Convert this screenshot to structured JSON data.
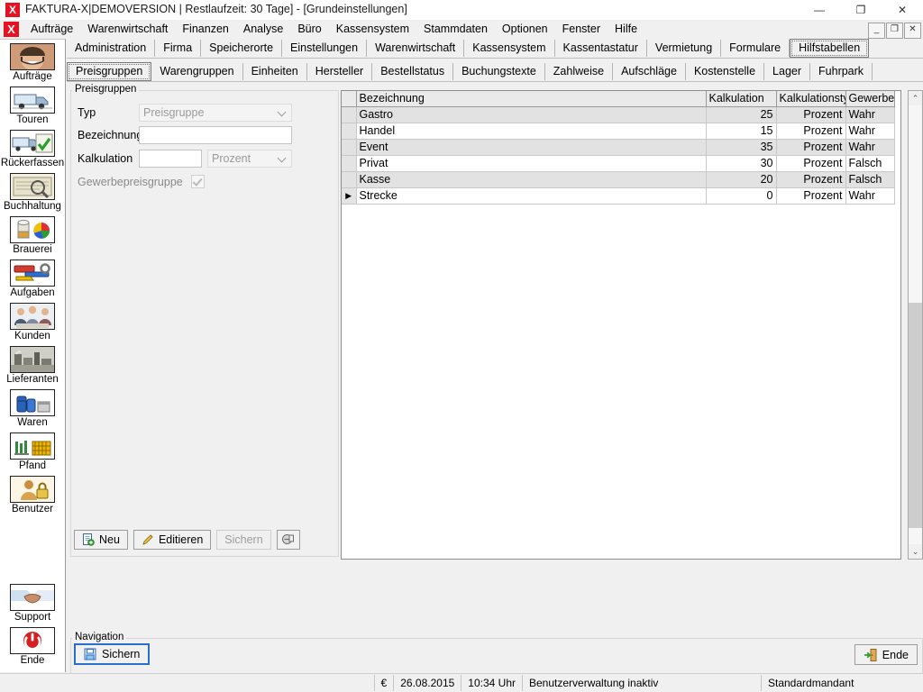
{
  "window": {
    "title": "FAKTURA-X|DEMOVERSION | Restlaufzeit: 30 Tage] - [Grundeinstellungen]",
    "logo_text": "X",
    "minimize": "—",
    "maximize": "❐",
    "close": "✕",
    "mdi_minimize": "_",
    "mdi_restore": "❐",
    "mdi_close": "✕"
  },
  "menubar": {
    "logo_text": "X",
    "items": [
      "Aufträge",
      "Warenwirtschaft",
      "Finanzen",
      "Analyse",
      "Büro",
      "Kassensystem",
      "Stammdaten",
      "Optionen",
      "Fenster",
      "Hilfe"
    ]
  },
  "sidebar": {
    "items": [
      {
        "label": "Aufträge",
        "icon": "headset-operator-icon"
      },
      {
        "label": "Touren",
        "icon": "truck-icon"
      },
      {
        "label": "Rückerfassen",
        "icon": "truck-check-icon"
      },
      {
        "label": "Buchhaltung",
        "icon": "ledger-magnifier-icon"
      },
      {
        "label": "Brauerei",
        "icon": "beer-tap-icon"
      },
      {
        "label": "Aufgaben",
        "icon": "tools-icon"
      },
      {
        "label": "Kunden",
        "icon": "people-meeting-icon"
      },
      {
        "label": "Lieferanten",
        "icon": "factory-icon"
      },
      {
        "label": "Waren",
        "icon": "barrels-icon"
      },
      {
        "label": "Pfand",
        "icon": "bottle-crate-icon"
      },
      {
        "label": "Benutzer",
        "icon": "user-lock-icon"
      }
    ],
    "bottom_items": [
      {
        "label": "Support",
        "icon": "handshake-icon"
      },
      {
        "label": "Ende",
        "icon": "power-icon"
      }
    ]
  },
  "tabs_primary": {
    "items": [
      "Administration",
      "Firma",
      "Speicherorte",
      "Einstellungen",
      "Warenwirtschaft",
      "Kassensystem",
      "Kassentastatur",
      "Vermietung",
      "Formulare",
      "Hilfstabellen"
    ],
    "selected": "Hilfstabellen"
  },
  "tabs_secondary": {
    "items": [
      "Preisgruppen",
      "Warengruppen",
      "Einheiten",
      "Hersteller",
      "Bestellstatus",
      "Buchungstexte",
      "Zahlweise",
      "Aufschläge",
      "Kostenstelle",
      "Lager",
      "Fuhrpark"
    ],
    "selected": "Preisgruppen"
  },
  "form": {
    "legend": "Preisgruppen",
    "typ_label": "Typ",
    "typ_value": "Preisgruppe",
    "bezeichnung_label": "Bezeichnung",
    "bezeichnung_value": "",
    "bezeichnung_placeholder": "",
    "kalkulation_label": "Kalkulation",
    "kalkulation_value": "",
    "kalkulation_placeholder": "",
    "kalkulationstyp_value": "Prozent",
    "gewerbe_label": "Gewerbepreisgruppe",
    "gewerbe_checked": "true",
    "buttons": {
      "neu": "Neu",
      "editieren": "Editieren",
      "sichern": "Sichern",
      "cancel_icon": "cancel-icon"
    }
  },
  "grid": {
    "columns": [
      "Bezeichnung",
      "Kalkulation",
      "Kalkulationstyp",
      "Gewerbe"
    ],
    "rows": [
      {
        "bezeichnung": "Gastro",
        "kalkulation": "25",
        "kalkulationstyp": "Prozent",
        "gewerbe": "Wahr",
        "current": "false"
      },
      {
        "bezeichnung": "Handel",
        "kalkulation": "15",
        "kalkulationstyp": "Prozent",
        "gewerbe": "Wahr",
        "current": "false"
      },
      {
        "bezeichnung": "Event",
        "kalkulation": "35",
        "kalkulationstyp": "Prozent",
        "gewerbe": "Wahr",
        "current": "false"
      },
      {
        "bezeichnung": "Privat",
        "kalkulation": "30",
        "kalkulationstyp": "Prozent",
        "gewerbe": "Falsch",
        "current": "false"
      },
      {
        "bezeichnung": "Kasse",
        "kalkulation": "20",
        "kalkulationstyp": "Prozent",
        "gewerbe": "Falsch",
        "current": "false"
      },
      {
        "bezeichnung": "Strecke",
        "kalkulation": "0",
        "kalkulationstyp": "Prozent",
        "gewerbe": "Wahr",
        "current": "true"
      }
    ],
    "current_row_marker": "▶",
    "scrollbar": {
      "up": "⌃",
      "down": "⌄"
    }
  },
  "navigation": {
    "legend": "Navigation",
    "sichern": "Sichern",
    "sichern_icon": "save-disk-icon",
    "ende": "Ende",
    "ende_icon": "exit-door-icon"
  },
  "statusbar": {
    "currency": "€",
    "date": "26.08.2015",
    "time": "10:34 Uhr",
    "user_mgmt": "Benutzerverwaltung inaktiv",
    "mandant": "Standardmandant"
  },
  "colors": {
    "accent": "#2a6fc9",
    "brand_red": "#e81123",
    "window_bg": "#f0f0f0",
    "grid_alt_row": "#e2e2e2"
  }
}
